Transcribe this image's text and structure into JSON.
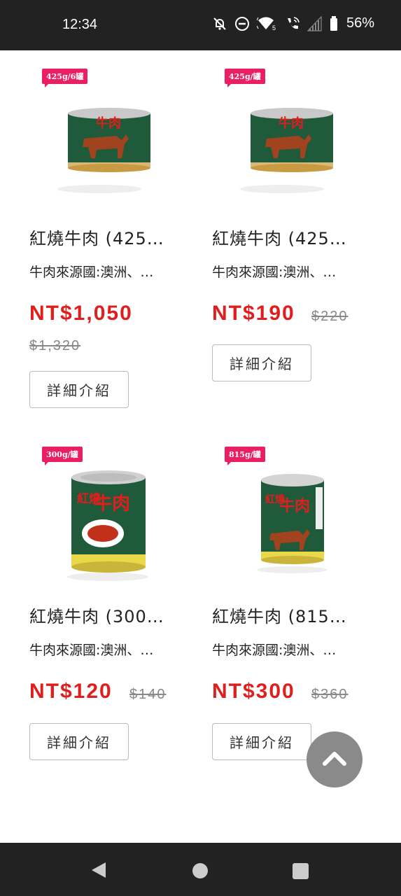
{
  "status": {
    "time": "12:34",
    "battery": "56%",
    "icons": [
      "notifications-off-icon",
      "do-not-disturb-icon",
      "wifi-icon",
      "wifi-calling-icon",
      "signal-icon",
      "battery-icon"
    ]
  },
  "products": [
    {
      "tag": "425g/6罐",
      "title": "紅燒牛肉 (425…",
      "subtitle": "牛肉來源國:澳洲、…",
      "price": "NT$1,050",
      "old_price": "$1,320",
      "button": "詳細介紹"
    },
    {
      "tag": "425g/罐",
      "title": "紅燒牛肉 (425…",
      "subtitle": "牛肉來源國:澳洲、…",
      "price": "NT$190",
      "old_price": "$220",
      "button": "詳細介紹"
    },
    {
      "tag": "300g/罐",
      "title": "紅燒牛肉 (300…",
      "subtitle": "牛肉來源國:澳洲、…",
      "price": "NT$120",
      "old_price": "$140",
      "button": "詳細介紹"
    },
    {
      "tag": "815g/罐",
      "title": "紅燒牛肉 (815…",
      "subtitle": "牛肉來源國:澳洲、…",
      "price": "NT$300",
      "old_price": "$360",
      "button": "詳細介紹"
    }
  ],
  "can_labels": {
    "short_can": "牛肉",
    "tall_can_1": "紅燒",
    "tall_can_2": "牛肉"
  },
  "colors": {
    "price_red": "#e01e1e",
    "tag_pink": "#e91e63",
    "can_green": "#1f5a3a"
  }
}
